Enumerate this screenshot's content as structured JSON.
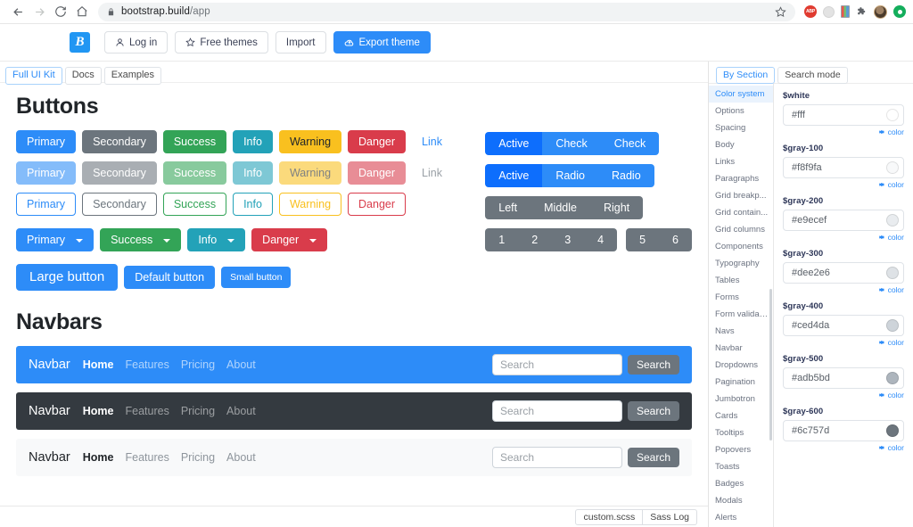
{
  "browser": {
    "url_host": "bootstrap.build",
    "url_path": "/app",
    "back_icon": "back-arrow-icon",
    "forward_icon": "forward-arrow-icon",
    "reload_icon": "reload-icon",
    "home_icon": "home-icon",
    "lock_icon": "lock-icon",
    "star_icon": "bookmark-star-icon",
    "extensions": [
      "adblock-icon",
      "grey-circle-icon",
      "book-stack-icon",
      "puzzle-piece-icon",
      "profile-avatar",
      "green-circle-icon"
    ]
  },
  "header": {
    "logo_letter": "B",
    "buttons": [
      {
        "label": "Log in",
        "icon": "user-icon",
        "style": "default"
      },
      {
        "label": "Free themes",
        "icon": "star-icon",
        "style": "default"
      },
      {
        "label": "Import",
        "icon": "",
        "style": "default"
      },
      {
        "label": "Export theme",
        "icon": "cloud-upload-icon",
        "style": "primary"
      }
    ]
  },
  "kit_tabs": [
    {
      "label": "Full UI Kit",
      "active": true
    },
    {
      "label": "Docs",
      "active": false
    },
    {
      "label": "Examples",
      "active": false
    }
  ],
  "sections": {
    "buttons_title": "Buttons",
    "navbars_title": "Navbars"
  },
  "colors": {
    "primary": "#2d8cf8",
    "primary_dark": "#0d6efd",
    "secondary": "#6c757d",
    "success": "#33a457",
    "info": "#23a2b8",
    "warning": "#f9c01f",
    "danger": "#d93c4b",
    "link": "#2d8cf8",
    "dark": "#343a40",
    "light": "#f8f9fa"
  },
  "buttons": {
    "solid_row": [
      {
        "label": "Primary",
        "variant": "primary"
      },
      {
        "label": "Secondary",
        "variant": "secondary"
      },
      {
        "label": "Success",
        "variant": "success"
      },
      {
        "label": "Info",
        "variant": "info"
      },
      {
        "label": "Warning",
        "variant": "warning"
      },
      {
        "label": "Danger",
        "variant": "danger"
      }
    ],
    "solid_link": "Link",
    "disabled_row": [
      {
        "label": "Primary",
        "variant": "primary"
      },
      {
        "label": "Secondary",
        "variant": "secondary"
      },
      {
        "label": "Success",
        "variant": "success"
      },
      {
        "label": "Info",
        "variant": "info"
      },
      {
        "label": "Warning",
        "variant": "warning"
      },
      {
        "label": "Danger",
        "variant": "danger"
      }
    ],
    "disabled_link": "Link",
    "outline_row": [
      {
        "label": "Primary",
        "variant": "primary"
      },
      {
        "label": "Secondary",
        "variant": "secondary"
      },
      {
        "label": "Success",
        "variant": "success"
      },
      {
        "label": "Info",
        "variant": "info"
      },
      {
        "label": "Warning",
        "variant": "warning"
      },
      {
        "label": "Danger",
        "variant": "danger"
      }
    ],
    "dropdown_row": [
      {
        "label": "Primary",
        "variant": "primary"
      },
      {
        "label": "Success",
        "variant": "success"
      },
      {
        "label": "Info",
        "variant": "info"
      },
      {
        "label": "Danger",
        "variant": "danger"
      }
    ],
    "size_row": [
      {
        "label": "Large button",
        "size": "lg"
      },
      {
        "label": "Default button",
        "size": "md"
      },
      {
        "label": "Small button",
        "size": "sm"
      }
    ]
  },
  "button_groups": {
    "checkbox_group": [
      {
        "label": "Active",
        "active": true
      },
      {
        "label": "Check",
        "active": false
      },
      {
        "label": "Check",
        "active": false
      }
    ],
    "radio_group": [
      {
        "label": "Active",
        "active": true
      },
      {
        "label": "Radio",
        "active": false
      },
      {
        "label": "Radio",
        "active": false
      }
    ],
    "lmr_group": [
      "Left",
      "Middle",
      "Right"
    ],
    "num_group_a": [
      "1",
      "2",
      "3",
      "4"
    ],
    "num_group_b": [
      "5",
      "6"
    ]
  },
  "navbars": [
    {
      "theme": "primary",
      "brand": "Navbar",
      "links": [
        {
          "label": "Home",
          "active": true
        },
        {
          "label": "Features",
          "active": false
        },
        {
          "label": "Pricing",
          "active": false
        },
        {
          "label": "About",
          "active": false
        }
      ],
      "search_placeholder": "Search",
      "search_button": "Search"
    },
    {
      "theme": "dark",
      "brand": "Navbar",
      "links": [
        {
          "label": "Home",
          "active": true
        },
        {
          "label": "Features",
          "active": false
        },
        {
          "label": "Pricing",
          "active": false
        },
        {
          "label": "About",
          "active": false
        }
      ],
      "search_placeholder": "Search",
      "search_button": "Search"
    },
    {
      "theme": "light",
      "brand": "Navbar",
      "links": [
        {
          "label": "Home",
          "active": true
        },
        {
          "label": "Features",
          "active": false
        },
        {
          "label": "Pricing",
          "active": false
        },
        {
          "label": "About",
          "active": false
        }
      ],
      "search_placeholder": "Search",
      "search_button": "Search"
    }
  ],
  "bottom_bar": {
    "file_button": "custom.scss",
    "log_button": "Sass Log"
  },
  "sidebar": {
    "tabs": [
      {
        "label": "By Section",
        "active": true
      },
      {
        "label": "Search mode",
        "active": false
      }
    ],
    "nav_items": [
      {
        "label": "Color system",
        "active": true
      },
      {
        "label": "Options",
        "active": false
      },
      {
        "label": "Spacing",
        "active": false
      },
      {
        "label": "Body",
        "active": false
      },
      {
        "label": "Links",
        "active": false
      },
      {
        "label": "Paragraphs",
        "active": false
      },
      {
        "label": "Grid breakp...",
        "active": false
      },
      {
        "label": "Grid contain...",
        "active": false
      },
      {
        "label": "Grid columns",
        "active": false
      },
      {
        "label": "Components",
        "active": false
      },
      {
        "label": "Typography",
        "active": false
      },
      {
        "label": "Tables",
        "active": false
      },
      {
        "label": "Forms",
        "active": false
      },
      {
        "label": "Form validat...",
        "active": false
      },
      {
        "label": "Navs",
        "active": false
      },
      {
        "label": "Navbar",
        "active": false
      },
      {
        "label": "Dropdowns",
        "active": false
      },
      {
        "label": "Pagination",
        "active": false
      },
      {
        "label": "Jumbotron",
        "active": false
      },
      {
        "label": "Cards",
        "active": false
      },
      {
        "label": "Tooltips",
        "active": false
      },
      {
        "label": "Popovers",
        "active": false
      },
      {
        "label": "Toasts",
        "active": false
      },
      {
        "label": "Badges",
        "active": false
      },
      {
        "label": "Modals",
        "active": false
      },
      {
        "label": "Alerts",
        "active": false
      }
    ],
    "meta_label": "color",
    "meta_icon": "gear-icon",
    "variables": [
      {
        "name": "$white",
        "value": "#fff",
        "swatch": "#ffffff"
      },
      {
        "name": "$gray-100",
        "value": "#f8f9fa",
        "swatch": "#f8f9fa"
      },
      {
        "name": "$gray-200",
        "value": "#e9ecef",
        "swatch": "#e9ecef"
      },
      {
        "name": "$gray-300",
        "value": "#dee2e6",
        "swatch": "#dee2e6"
      },
      {
        "name": "$gray-400",
        "value": "#ced4da",
        "swatch": "#ced4da"
      },
      {
        "name": "$gray-500",
        "value": "#adb5bd",
        "swatch": "#adb5bd"
      },
      {
        "name": "$gray-600",
        "value": "#6c757d",
        "swatch": "#6c757d"
      }
    ]
  }
}
